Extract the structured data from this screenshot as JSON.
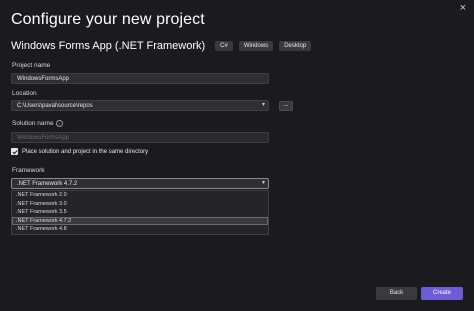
{
  "window": {
    "close_glyph": "×"
  },
  "heading": "Configure your new project",
  "template": {
    "name": "Windows Forms App (.NET Framework)",
    "tags": [
      "C#",
      "Windows",
      "Desktop"
    ]
  },
  "project_name": {
    "label": "Project name",
    "value": "WindowsFormsApp"
  },
  "location": {
    "label": "Location",
    "value": "C:\\Users\\paval\\source\\repos",
    "browse_label": "..."
  },
  "solution_name": {
    "label": "Solution name",
    "value": "WindowsFormsApp"
  },
  "place_in_same_dir": {
    "label": "Place solution and project in the same directory",
    "checked": true
  },
  "framework": {
    "label": "Framework",
    "selected": ".NET Framework 4.7.2",
    "options": [
      ".NET Framework 2.0",
      ".NET Framework 3.0",
      ".NET Framework 3.5",
      ".NET Framework 4.7.2",
      ".NET Framework 4.8"
    ]
  },
  "footer": {
    "back_label": "Back",
    "create_label": "Create"
  },
  "colors": {
    "accent": "#6e5bd6",
    "background": "#1b1b1f"
  },
  "icons": {
    "close": "close-icon",
    "dropdown": "chevron-down-icon",
    "info": "info-icon",
    "check": "checkmark-icon"
  }
}
